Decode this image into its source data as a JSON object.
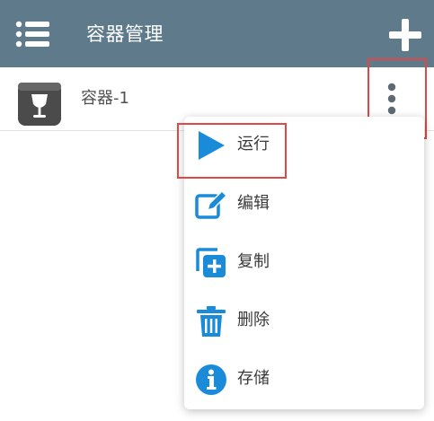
{
  "header": {
    "title": "容器管理",
    "menu_icon": "hamburger-list-icon",
    "add_icon": "plus-icon",
    "background_color": "#5f7a8b"
  },
  "container_list": [
    {
      "name": "容器-1",
      "icon": "wine-glass-container-icon",
      "more_icon": "vertical-more-icon"
    }
  ],
  "context_menu": {
    "items": [
      {
        "label": "运行",
        "icon": "play-icon"
      },
      {
        "label": "编辑",
        "icon": "edit-icon"
      },
      {
        "label": "复制",
        "icon": "copy-icon"
      },
      {
        "label": "删除",
        "icon": "trash-icon"
      },
      {
        "label": "存储",
        "icon": "info-icon"
      }
    ]
  },
  "colors": {
    "accent_blue": "#1a8bd8",
    "highlight_red": "#e04848"
  }
}
